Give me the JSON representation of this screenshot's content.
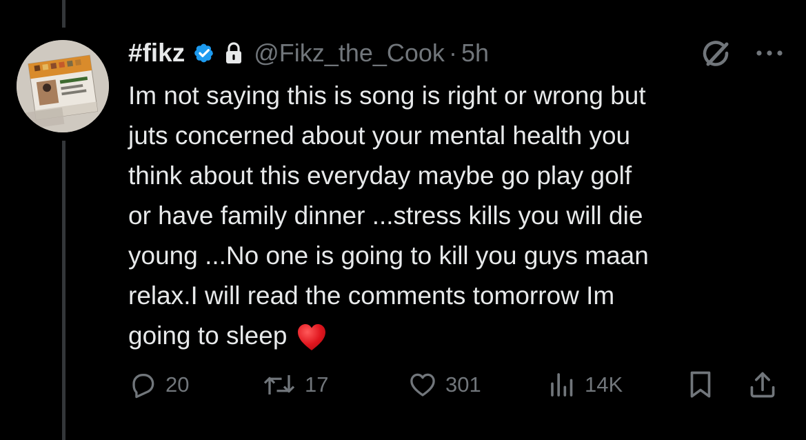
{
  "tweet": {
    "display_name": "#fikz",
    "handle": "@Fikz_the_Cook",
    "separator": "·",
    "time": "5h",
    "text_lines": [
      "Im not saying this is song is right or wrong but",
      "juts concerned about your mental health you",
      "think about this everyday maybe go play golf",
      "or have family dinner ...stress kills you will die",
      "young ...No one is going to kill you guys maan",
      "relax.I will read the comments tomorrow Im",
      "going to sleep"
    ],
    "emoji": "red-heart"
  },
  "actions": {
    "replies": "20",
    "reposts": "17",
    "likes": "301",
    "views": "14K"
  },
  "icons": {
    "verified": "verified-badge-icon",
    "protected": "lock-icon",
    "grok": "grok-icon",
    "more": "more-icon",
    "reply": "reply-icon",
    "repost": "repost-icon",
    "like": "heart-icon",
    "views": "views-icon",
    "bookmark": "bookmark-icon",
    "share": "share-icon"
  },
  "colors": {
    "background": "#000000",
    "text": "#e7e9ea",
    "secondary": "#71767b",
    "verified": "#1d9bf0",
    "heart": "#e0161e"
  }
}
